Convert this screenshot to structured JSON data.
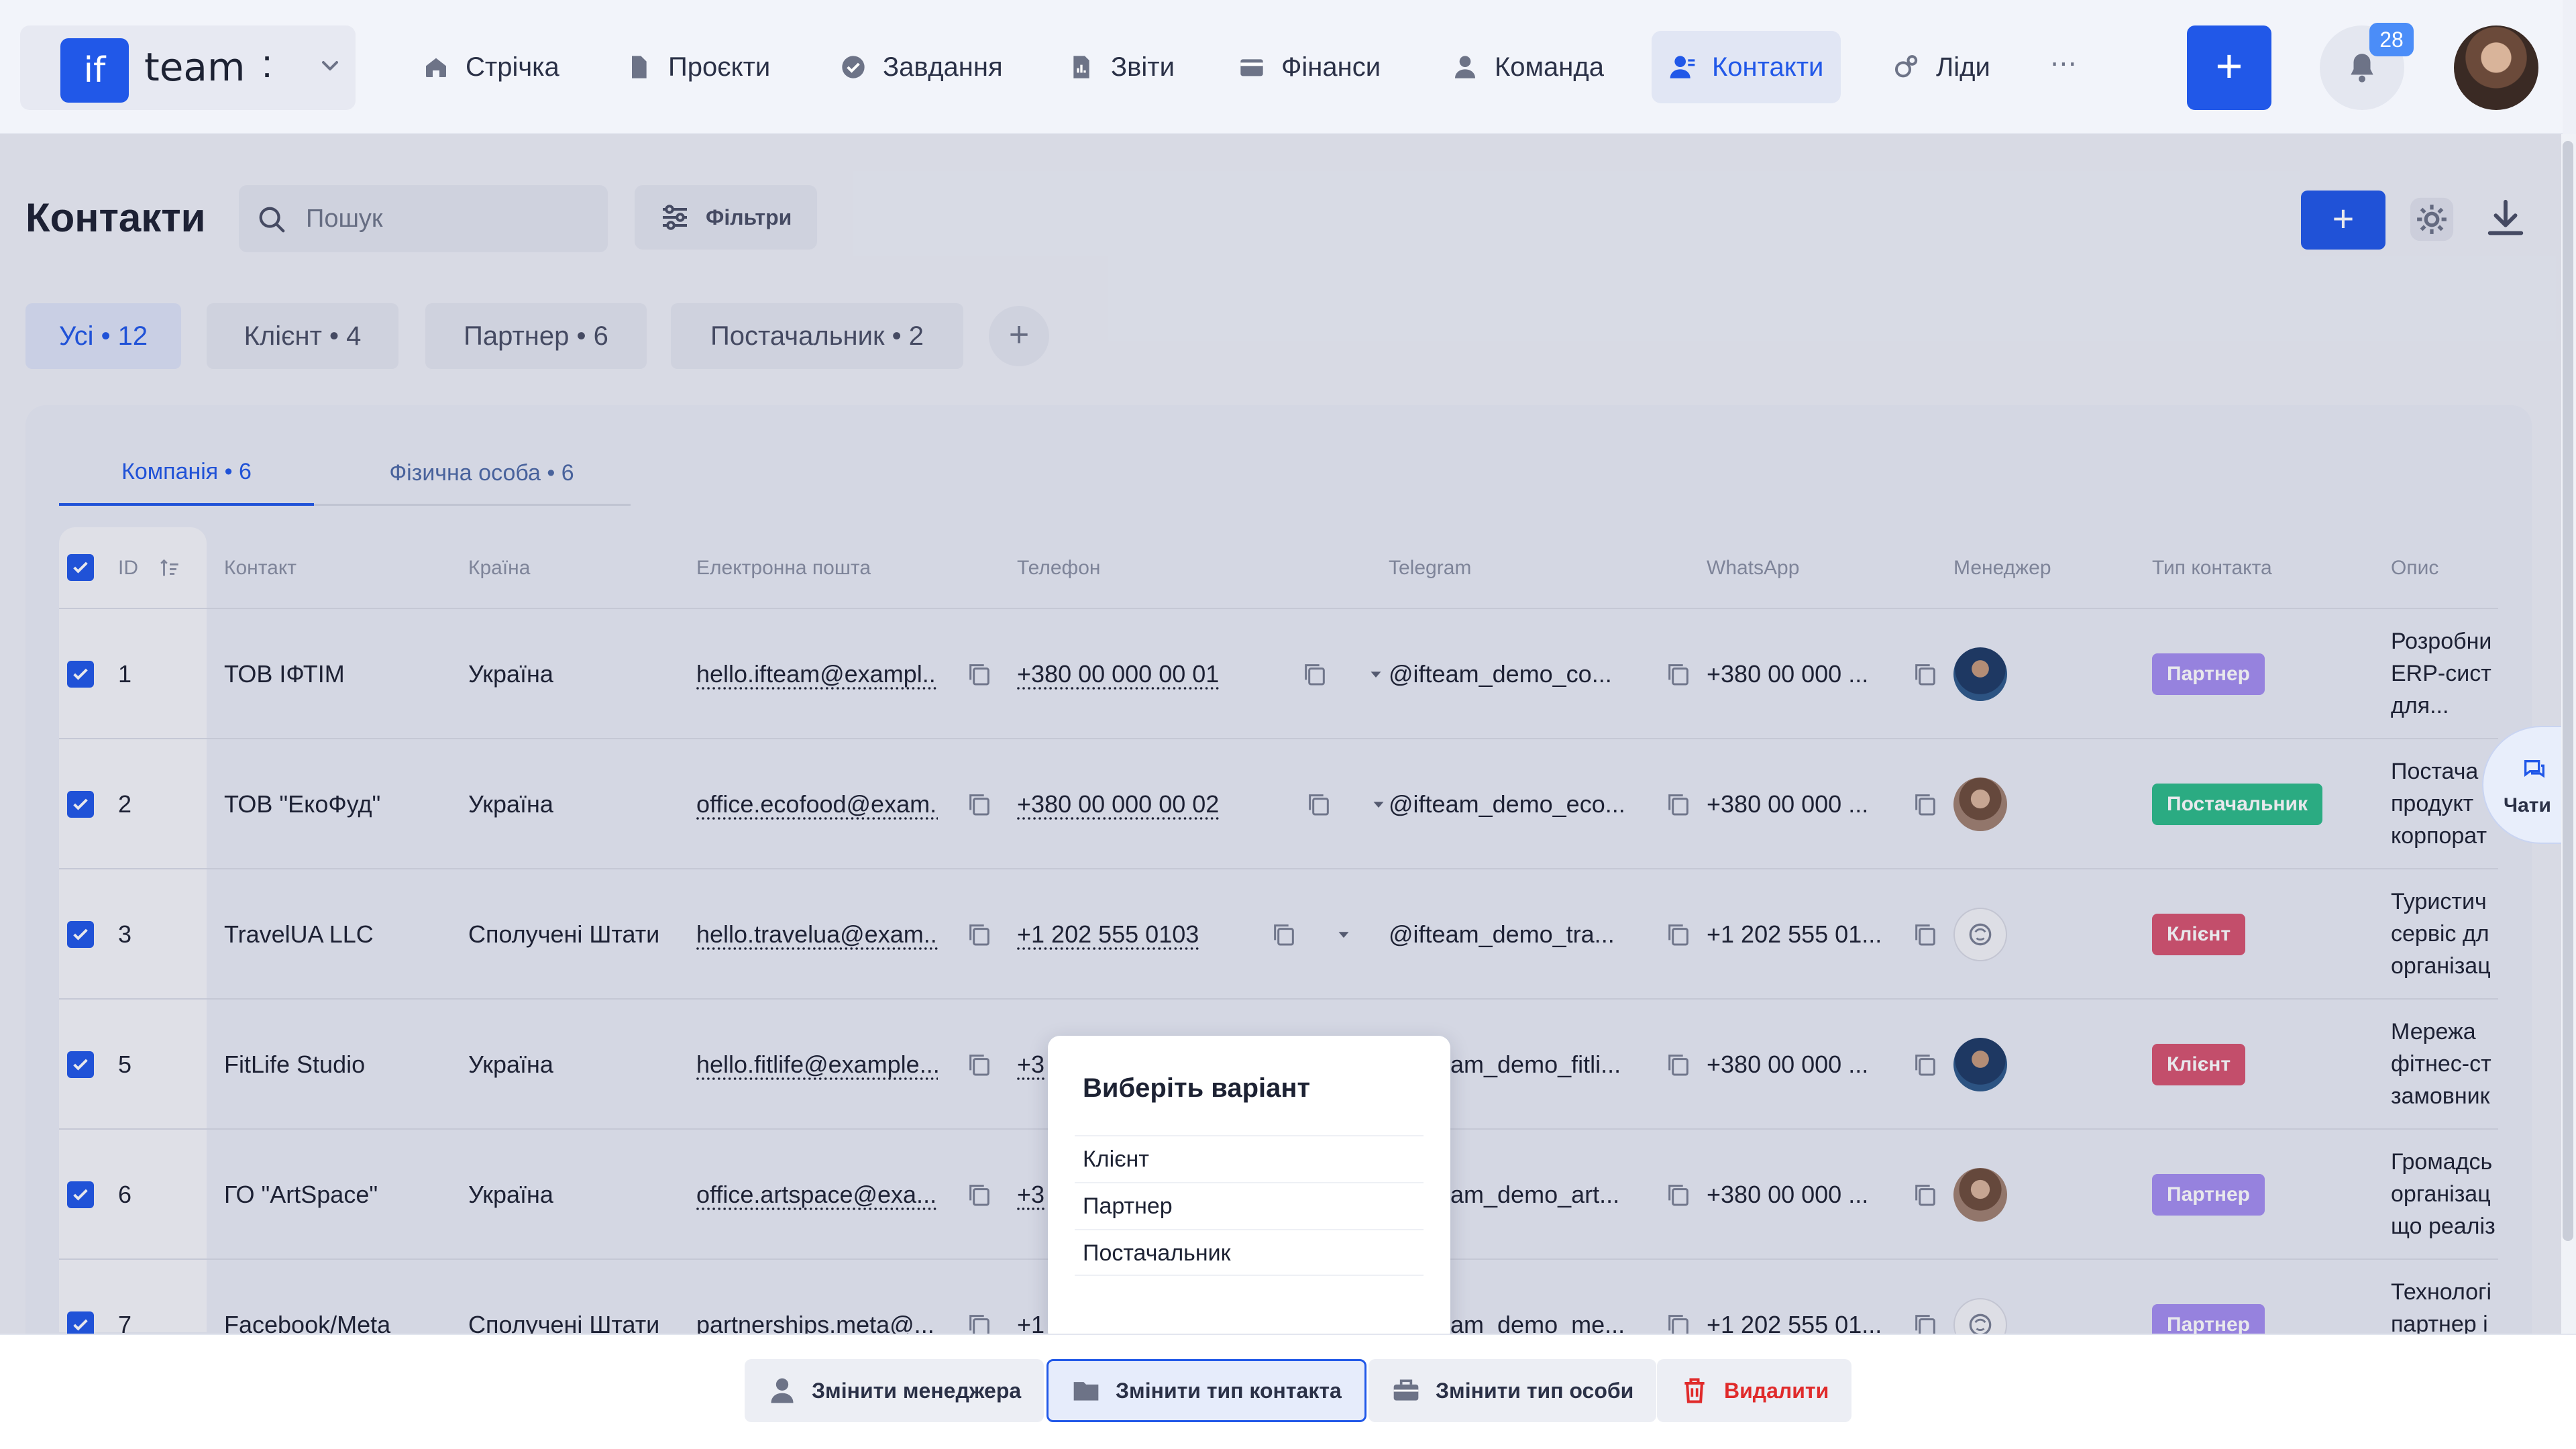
{
  "brand": {
    "logo": "if",
    "name": "team",
    "dots": ":"
  },
  "nav": [
    {
      "label": "Стрічка",
      "icon": "home-icon"
    },
    {
      "label": "Проєкти",
      "icon": "document-icon"
    },
    {
      "label": "Завдання",
      "icon": "check-circle-icon"
    },
    {
      "label": "Звіти",
      "icon": "report-icon"
    },
    {
      "label": "Фінанси",
      "icon": "wallet-icon"
    },
    {
      "label": "Команда",
      "icon": "person-icon"
    },
    {
      "label": "Контакти",
      "icon": "contacts-icon",
      "active": true
    },
    {
      "label": "Ліди",
      "icon": "leads-icon"
    }
  ],
  "nav_more": "⋯",
  "notifications_count": "28",
  "page": {
    "title": "Контакти",
    "search_placeholder": "Пошук",
    "filters_label": "Фільтри",
    "add_label": "+"
  },
  "type_tabs": [
    {
      "label": "Усі • 12",
      "active": true
    },
    {
      "label": "Клієнт • 4"
    },
    {
      "label": "Партнер • 6"
    },
    {
      "label": "Постачальник • 2"
    }
  ],
  "sub_tabs": [
    {
      "label": "Компанія • 6",
      "active": true
    },
    {
      "label": "Фізична особа • 6"
    }
  ],
  "columns": [
    "ID",
    "Контакт",
    "Країна",
    "Електронна пошта",
    "Телефон",
    "Telegram",
    "WhatsApp",
    "Менеджер",
    "Тип контакта",
    "Опис"
  ],
  "rows": [
    {
      "id": "1",
      "contact": "ТОВ ІФТІМ",
      "country": "Україна",
      "email": "hello.ifteam@exampl...",
      "phone": "+380 00 000 00 01",
      "telegram": "@ifteam_demo_co...",
      "whatsapp": "+380 00 000 ...",
      "manager": "a",
      "type": "Партнер",
      "type_class": "partner",
      "desc": [
        "Розробни",
        "ERP-сист",
        "для..."
      ]
    },
    {
      "id": "2",
      "contact": "ТОВ \"ЕкоФуд\"",
      "country": "Україна",
      "email": "office.ecofood@exam...",
      "phone": "+380 00 000 00 02",
      "telegram": "@ifteam_demo_eco...",
      "whatsapp": "+380 00 000 ...",
      "manager": "b",
      "type": "Постачальник",
      "type_class": "supplier",
      "desc": [
        "Постача",
        "продукт",
        "корпорат"
      ]
    },
    {
      "id": "3",
      "contact": "TravelUA LLC",
      "country": "Сполучені Штати",
      "email": "hello.travelua@exam...",
      "phone": "+1 202 555 0103",
      "telegram": "@ifteam_demo_tra...",
      "whatsapp": "+1 202 555 01...",
      "manager": "c",
      "type": "Клієнт",
      "type_class": "client",
      "desc": [
        "Туристич",
        "сервіс дл",
        "організац"
      ]
    },
    {
      "id": "5",
      "contact": "FitLife Studio",
      "country": "Україна",
      "email": "hello.fitlife@example...",
      "phone": "+3",
      "telegram": "am_demo_fitli...",
      "whatsapp": "+380 00 000 ...",
      "manager": "a",
      "type": "Клієнт",
      "type_class": "client",
      "desc": [
        "Мережа",
        "фітнес-ст",
        "замовник"
      ]
    },
    {
      "id": "6",
      "contact": "ГО \"ArtSpace\"",
      "country": "Україна",
      "email": "office.artspace@exa...",
      "phone": "+3",
      "telegram": "am_demo_art...",
      "whatsapp": "+380 00 000 ...",
      "manager": "b",
      "type": "Партнер",
      "type_class": "partner",
      "desc": [
        "Громадсь",
        "організац",
        "що реаліз"
      ]
    },
    {
      "id": "7",
      "contact": "Facebook/Meta",
      "country": "Сполучені Штати",
      "email": "partnerships.meta@...",
      "phone": "+1",
      "telegram": "am_demo_me...",
      "whatsapp": "+1 202 555 01...",
      "manager": "c",
      "type": "Партнер",
      "type_class": "partner",
      "desc": [
        "Технологі",
        "партнер і",
        ""
      ]
    }
  ],
  "chats_label": "Чати",
  "popup": {
    "title": "Виберіть варіант",
    "options": [
      "Клієнт",
      "Партнер",
      "Постачальник"
    ]
  },
  "actions": [
    {
      "label": "Змінити менеджера",
      "icon": "person-icon"
    },
    {
      "label": "Змінити тип контакта",
      "icon": "folder-icon",
      "selected": true
    },
    {
      "label": "Змінити тип особи",
      "icon": "briefcase-icon"
    },
    {
      "label": "Видалити",
      "icon": "trash-icon",
      "danger": true
    }
  ],
  "colors": {
    "accent": "#2158e8",
    "partner": "#a48ef0",
    "supplier": "#2dbb8a",
    "client": "#d65470",
    "danger": "#e02b2b"
  }
}
